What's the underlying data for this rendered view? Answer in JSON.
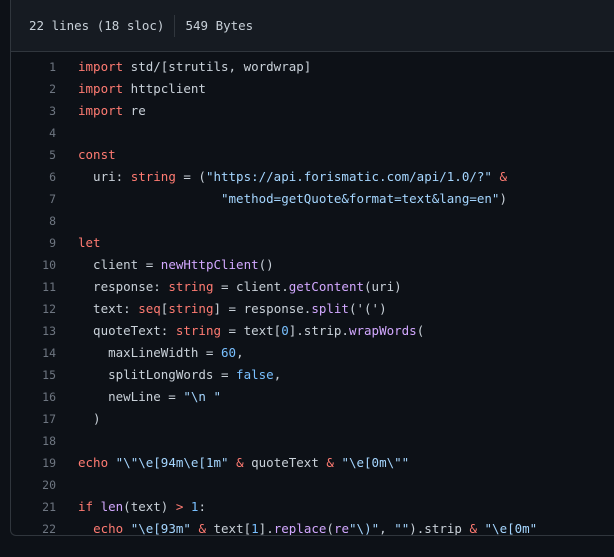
{
  "file_info": {
    "lines": "22 lines (18 sloc)",
    "size": "549 Bytes"
  },
  "colors": {
    "background": "#0d1117",
    "header_background": "#161b22",
    "border": "#30363d",
    "keyword": "#ff7b72",
    "string": "#a5d6ff",
    "function": "#d2a8ff",
    "number": "#79c0ff",
    "line_number": "#6e7681",
    "text": "#c9d1d9"
  },
  "code_lines": [
    {
      "n": "1",
      "tokens": [
        [
          "kw",
          "import"
        ],
        [
          "t",
          " std/[strutils, wordwrap]"
        ]
      ]
    },
    {
      "n": "2",
      "tokens": [
        [
          "kw",
          "import"
        ],
        [
          "t",
          " httpclient"
        ]
      ]
    },
    {
      "n": "3",
      "tokens": [
        [
          "kw",
          "import"
        ],
        [
          "t",
          " re"
        ]
      ]
    },
    {
      "n": "4",
      "tokens": []
    },
    {
      "n": "5",
      "tokens": [
        [
          "kw",
          "const"
        ]
      ]
    },
    {
      "n": "6",
      "tokens": [
        [
          "t",
          "  uri: "
        ],
        [
          "kw",
          "string"
        ],
        [
          "t",
          " = ("
        ],
        [
          "str",
          "\"https://api.forismatic.com/api/1.0/?\""
        ],
        [
          "t",
          " "
        ],
        [
          "kw",
          "&"
        ]
      ]
    },
    {
      "n": "7",
      "tokens": [
        [
          "t",
          "                   "
        ],
        [
          "str",
          "\"method=getQuote&format=text&lang=en\""
        ],
        [
          "t",
          ")"
        ]
      ]
    },
    {
      "n": "8",
      "tokens": []
    },
    {
      "n": "9",
      "tokens": [
        [
          "kw",
          "let"
        ]
      ]
    },
    {
      "n": "10",
      "tokens": [
        [
          "t",
          "  client = "
        ],
        [
          "fn",
          "newHttpClient"
        ],
        [
          "t",
          "()"
        ]
      ]
    },
    {
      "n": "11",
      "tokens": [
        [
          "t",
          "  response: "
        ],
        [
          "kw",
          "string"
        ],
        [
          "t",
          " = client."
        ],
        [
          "fn",
          "getContent"
        ],
        [
          "t",
          "(uri)"
        ]
      ]
    },
    {
      "n": "12",
      "tokens": [
        [
          "t",
          "  text: "
        ],
        [
          "kw",
          "seq"
        ],
        [
          "t",
          "["
        ],
        [
          "kw",
          "string"
        ],
        [
          "t",
          "] = response."
        ],
        [
          "fn",
          "split"
        ],
        [
          "t",
          "('(')"
        ]
      ]
    },
    {
      "n": "13",
      "tokens": [
        [
          "t",
          "  quoteText: "
        ],
        [
          "kw",
          "string"
        ],
        [
          "t",
          " = text["
        ],
        [
          "num",
          "0"
        ],
        [
          "t",
          "].strip."
        ],
        [
          "fn",
          "wrapWords"
        ],
        [
          "t",
          "("
        ]
      ]
    },
    {
      "n": "14",
      "tokens": [
        [
          "t",
          "    maxLineWidth = "
        ],
        [
          "num",
          "60"
        ],
        [
          "t",
          ","
        ]
      ]
    },
    {
      "n": "15",
      "tokens": [
        [
          "t",
          "    splitLongWords = "
        ],
        [
          "num",
          "false"
        ],
        [
          "t",
          ","
        ]
      ]
    },
    {
      "n": "16",
      "tokens": [
        [
          "t",
          "    newLine = "
        ],
        [
          "str",
          "\"\\n \""
        ]
      ]
    },
    {
      "n": "17",
      "tokens": [
        [
          "t",
          "  )"
        ]
      ]
    },
    {
      "n": "18",
      "tokens": []
    },
    {
      "n": "19",
      "tokens": [
        [
          "kw",
          "echo"
        ],
        [
          "t",
          " "
        ],
        [
          "str",
          "\"\\\"\\e[94m\\e[1m\""
        ],
        [
          "t",
          " "
        ],
        [
          "kw",
          "&"
        ],
        [
          "t",
          " quoteText "
        ],
        [
          "kw",
          "&"
        ],
        [
          "t",
          " "
        ],
        [
          "str",
          "\"\\e[0m\\\"\""
        ]
      ]
    },
    {
      "n": "20",
      "tokens": []
    },
    {
      "n": "21",
      "tokens": [
        [
          "kw",
          "if"
        ],
        [
          "t",
          " "
        ],
        [
          "fn",
          "len"
        ],
        [
          "t",
          "(text) "
        ],
        [
          "kw",
          ">"
        ],
        [
          "t",
          " "
        ],
        [
          "num",
          "1"
        ],
        [
          "t",
          ":"
        ]
      ]
    },
    {
      "n": "22",
      "tokens": [
        [
          "t",
          "  "
        ],
        [
          "kw",
          "echo"
        ],
        [
          "t",
          " "
        ],
        [
          "str",
          "\"\\e[93m\""
        ],
        [
          "t",
          " "
        ],
        [
          "kw",
          "&"
        ],
        [
          "t",
          " text["
        ],
        [
          "num",
          "1"
        ],
        [
          "t",
          "]."
        ],
        [
          "fn",
          "replace"
        ],
        [
          "t",
          "("
        ],
        [
          "fn",
          "re"
        ],
        [
          "str",
          "\"\\)\""
        ],
        [
          "t",
          ", "
        ],
        [
          "str",
          "\"\""
        ],
        [
          "t",
          ").strip "
        ],
        [
          "kw",
          "&"
        ],
        [
          "t",
          " "
        ],
        [
          "str",
          "\"\\e[0m\""
        ]
      ]
    }
  ]
}
